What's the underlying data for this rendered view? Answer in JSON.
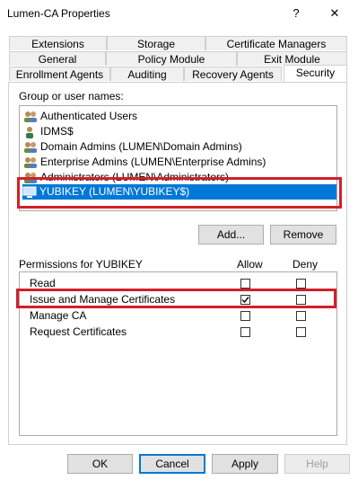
{
  "window": {
    "title": "Lumen-CA Properties",
    "help_glyph": "?",
    "close_glyph": "✕"
  },
  "tabs": {
    "row1": [
      "Extensions",
      "Storage",
      "Certificate Managers"
    ],
    "row2": [
      "General",
      "Policy Module",
      "Exit Module"
    ],
    "row3": [
      "Enrollment Agents",
      "Auditing",
      "Recovery Agents",
      "Security"
    ],
    "active": "Security"
  },
  "security": {
    "group_label": "Group or user names:",
    "users": [
      "Authenticated Users",
      "IDMS$",
      "Domain Admins (LUMEN\\Domain Admins)",
      "Enterprise Admins (LUMEN\\Enterprise Admins)",
      "Administrators (LUMEN\\Administrators)",
      "YUBIKEY (LUMEN\\YUBIKEY$)"
    ],
    "selected_user": "YUBIKEY (LUMEN\\YUBIKEY$)",
    "add_label": "Add...",
    "remove_label": "Remove",
    "permissions_label": "Permissions for YUBIKEY",
    "allow_header": "Allow",
    "deny_header": "Deny",
    "permissions": [
      {
        "name": "Read",
        "allow": false,
        "deny": false
      },
      {
        "name": "Issue and Manage Certificates",
        "allow": true,
        "deny": false
      },
      {
        "name": "Manage CA",
        "allow": false,
        "deny": false
      },
      {
        "name": "Request Certificates",
        "allow": false,
        "deny": false
      }
    ]
  },
  "footer": {
    "ok_label": "OK",
    "cancel_label": "Cancel",
    "apply_label": "Apply",
    "help_label": "Help"
  },
  "colors": {
    "selection": "#0078d7",
    "highlight_box": "#d0202a"
  }
}
